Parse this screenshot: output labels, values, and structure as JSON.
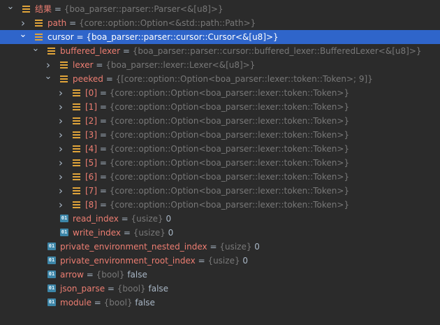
{
  "rows": [
    {
      "depth": 0,
      "arrow": "down",
      "icon": "object",
      "name": "结果",
      "sep": " = ",
      "type": "{boa_parser::parser::Parser<&[u8]>}",
      "value": ""
    },
    {
      "depth": 1,
      "arrow": "right",
      "icon": "object",
      "name": "path",
      "sep": " = ",
      "type": "{core::option::Option<&std::path::Path>}",
      "value": ""
    },
    {
      "depth": 1,
      "arrow": "down",
      "icon": "object",
      "name": "cursor",
      "sep": " = ",
      "type": "{boa_parser::parser::cursor::Cursor<&[u8]>}",
      "value": "",
      "selected": true
    },
    {
      "depth": 2,
      "arrow": "down",
      "icon": "object",
      "name": "buffered_lexer",
      "sep": " = ",
      "type": "{boa_parser::parser::cursor::buffered_lexer::BufferedLexer<&[u8]>}",
      "value": ""
    },
    {
      "depth": 3,
      "arrow": "right",
      "icon": "object",
      "name": "lexer",
      "sep": " = ",
      "type": "{boa_parser::lexer::Lexer<&[u8]>}",
      "value": ""
    },
    {
      "depth": 3,
      "arrow": "down",
      "icon": "object",
      "name": "peeked",
      "sep": " = ",
      "type": "{[core::option::Option<boa_parser::lexer::token::Token>; 9]}",
      "value": ""
    },
    {
      "depth": 4,
      "arrow": "right",
      "icon": "object",
      "name": "[0]",
      "sep": " = ",
      "type": "{core::option::Option<boa_parser::lexer::token::Token>}",
      "value": ""
    },
    {
      "depth": 4,
      "arrow": "right",
      "icon": "object",
      "name": "[1]",
      "sep": " = ",
      "type": "{core::option::Option<boa_parser::lexer::token::Token>}",
      "value": ""
    },
    {
      "depth": 4,
      "arrow": "right",
      "icon": "object",
      "name": "[2]",
      "sep": " = ",
      "type": "{core::option::Option<boa_parser::lexer::token::Token>}",
      "value": ""
    },
    {
      "depth": 4,
      "arrow": "right",
      "icon": "object",
      "name": "[3]",
      "sep": " = ",
      "type": "{core::option::Option<boa_parser::lexer::token::Token>}",
      "value": ""
    },
    {
      "depth": 4,
      "arrow": "right",
      "icon": "object",
      "name": "[4]",
      "sep": " = ",
      "type": "{core::option::Option<boa_parser::lexer::token::Token>}",
      "value": ""
    },
    {
      "depth": 4,
      "arrow": "right",
      "icon": "object",
      "name": "[5]",
      "sep": " = ",
      "type": "{core::option::Option<boa_parser::lexer::token::Token>}",
      "value": ""
    },
    {
      "depth": 4,
      "arrow": "right",
      "icon": "object",
      "name": "[6]",
      "sep": " = ",
      "type": "{core::option::Option<boa_parser::lexer::token::Token>}",
      "value": ""
    },
    {
      "depth": 4,
      "arrow": "right",
      "icon": "object",
      "name": "[7]",
      "sep": " = ",
      "type": "{core::option::Option<boa_parser::lexer::token::Token>}",
      "value": ""
    },
    {
      "depth": 4,
      "arrow": "right",
      "icon": "object",
      "name": "[8]",
      "sep": " = ",
      "type": "{core::option::Option<boa_parser::lexer::token::Token>}",
      "value": ""
    },
    {
      "depth": 3,
      "arrow": "none",
      "icon": "primitive",
      "name": "read_index",
      "sep": " = ",
      "type": "{usize}",
      "value": " 0"
    },
    {
      "depth": 3,
      "arrow": "none",
      "icon": "primitive",
      "name": "write_index",
      "sep": " = ",
      "type": "{usize}",
      "value": " 0"
    },
    {
      "depth": 2,
      "arrow": "none",
      "icon": "primitive",
      "name": "private_environment_nested_index",
      "sep": " = ",
      "type": "{usize}",
      "value": " 0"
    },
    {
      "depth": 2,
      "arrow": "none",
      "icon": "primitive",
      "name": "private_environment_root_index",
      "sep": " = ",
      "type": "{usize}",
      "value": " 0"
    },
    {
      "depth": 2,
      "arrow": "none",
      "icon": "primitive",
      "name": "arrow",
      "sep": " = ",
      "type": "{bool}",
      "value": " false"
    },
    {
      "depth": 2,
      "arrow": "none",
      "icon": "primitive",
      "name": "json_parse",
      "sep": " = ",
      "type": "{bool}",
      "value": " false"
    },
    {
      "depth": 2,
      "arrow": "none",
      "icon": "primitive",
      "name": "module",
      "sep": " = ",
      "type": "{bool}",
      "value": " false"
    }
  ],
  "icons": {
    "object": "object-field-icon",
    "primitive": "primitive-field-icon",
    "primitive_badge": "01",
    "expanded": "chevron-down-icon",
    "collapsed": "chevron-right-icon"
  },
  "colors": {
    "background": "#2b2b2b",
    "selection": "#2f65ca",
    "name": "#ed7e72",
    "type": "#787878",
    "text": "#a9b7c6",
    "object_icon": "#e0a43a",
    "primitive_icon": "#3d86a8"
  }
}
